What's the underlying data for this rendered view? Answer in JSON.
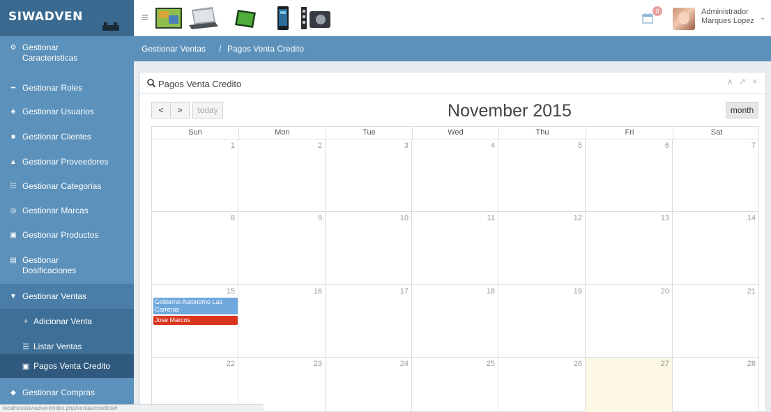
{
  "app": {
    "brand": "SIWADVEN"
  },
  "header": {
    "menu_icon": "hamburger-icon",
    "notification_count": "0",
    "user_role": "Administrador",
    "user_name": "Marques Lopez",
    "caret": "⌄"
  },
  "sidebar": {
    "items": [
      {
        "icon": "gears-icon",
        "glyph": "⚙",
        "label": "Gestionar Caracteristicas"
      },
      {
        "icon": "roles-icon",
        "glyph": "━",
        "label": "Gestionar Roles"
      },
      {
        "icon": "users-icon",
        "glyph": "♣",
        "label": "Gestionar Usuarios"
      },
      {
        "icon": "clients-icon",
        "glyph": "■",
        "label": "Gestionar Clientes"
      },
      {
        "icon": "truck-icon",
        "glyph": "▲",
        "label": "Gestionar Proveedores"
      },
      {
        "icon": "sitemap-icon",
        "glyph": "☷",
        "label": "Gestionar Categorias"
      },
      {
        "icon": "brand-icon",
        "glyph": "◎",
        "label": "Gestionar Marcas"
      },
      {
        "icon": "products-icon",
        "glyph": "▣",
        "label": "Gestionar Productos"
      },
      {
        "icon": "dosage-icon",
        "glyph": "▤",
        "label": "Gestionar Dosificaciones"
      },
      {
        "icon": "cart-icon",
        "glyph": "▼",
        "label": "Gestionar Ventas"
      },
      {
        "icon": "purchases-icon",
        "glyph": "◆",
        "label": "Gestionar Compras"
      }
    ],
    "sub_items": [
      {
        "icon": "plus-icon",
        "glyph": "+",
        "label": "Adicionar Venta"
      },
      {
        "icon": "list-icon",
        "glyph": "☰",
        "label": "Listar Ventas"
      },
      {
        "icon": "credit-card-icon",
        "glyph": "▣",
        "label": "Pagos Venta Credito"
      }
    ]
  },
  "breadcrumb": {
    "parent": "Gestionar Ventas",
    "separator": "/",
    "current": "Pagos Venta Credito"
  },
  "panel": {
    "title": "Pagos Venta Credito",
    "controls": [
      "∧",
      "↗",
      "×"
    ]
  },
  "calendar": {
    "prev": "<",
    "next": ">",
    "today_label": "today",
    "title": "November 2015",
    "view_label": "month",
    "days_of_week": [
      "Sun",
      "Mon",
      "Tue",
      "Wed",
      "Thu",
      "Fri",
      "Sat"
    ],
    "weeks": [
      [
        "1",
        "2",
        "3",
        "4",
        "5",
        "6",
        "7"
      ],
      [
        "8",
        "9",
        "10",
        "11",
        "12",
        "13",
        "14"
      ],
      [
        "15",
        "16",
        "17",
        "18",
        "19",
        "20",
        "21"
      ],
      [
        "22",
        "23",
        "24",
        "25",
        "26",
        "27",
        "28"
      ]
    ],
    "today_day": "27",
    "events": [
      {
        "day": "15",
        "title": "Gobierno Autonomo Las Carreras",
        "color": "#6fa8dc"
      },
      {
        "day": "15",
        "title": "Jose Marcos",
        "color": "#d9341c"
      }
    ]
  },
  "statusbar": {
    "url": "localhost/siwadven/index.php/ventas/creditos#"
  },
  "colors": {
    "sidebar": "#5b91bb",
    "brand_bg": "#3a6a8f",
    "today_bg": "#fcf8e3"
  }
}
